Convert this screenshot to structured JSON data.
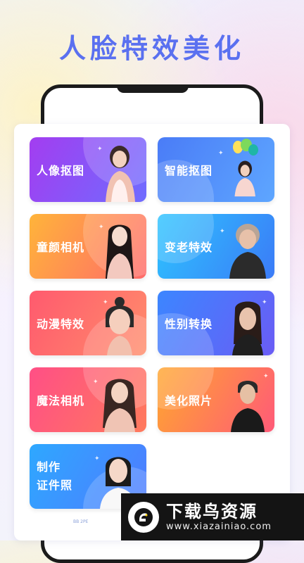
{
  "headline": "人脸特效美化",
  "cards": [
    {
      "label": "人像抠图",
      "gradient": [
        "#a33df0",
        "#6f6cff"
      ]
    },
    {
      "label": "智能抠图",
      "gradient": [
        "#4a7cf7",
        "#5ea6ff"
      ]
    },
    {
      "label": "童颜相机",
      "gradient": [
        "#ffb43a",
        "#ff6a6a"
      ]
    },
    {
      "label": "变老特效",
      "gradient": [
        "#2ec4ff",
        "#3b7bf7"
      ]
    },
    {
      "label": "动漫特效",
      "gradient": [
        "#ff5a6e",
        "#ff8c6b"
      ]
    },
    {
      "label": "性别转换",
      "gradient": [
        "#3c86ff",
        "#6a5cf5"
      ]
    },
    {
      "label": "魔法相机",
      "gradient": [
        "#ff4f86",
        "#ff7a5c"
      ]
    },
    {
      "label": "美化照片",
      "gradient": [
        "#ffa72f",
        "#ff5a78"
      ]
    },
    {
      "label_line1": "制作",
      "label_line2": "证件照",
      "gradient": [
        "#2ea8ff",
        "#4f7bff"
      ]
    }
  ],
  "watermark": {
    "name": "下载鸟资源",
    "url": "www.xiazainiao.com"
  },
  "footer_tiny": "BB 2PE"
}
